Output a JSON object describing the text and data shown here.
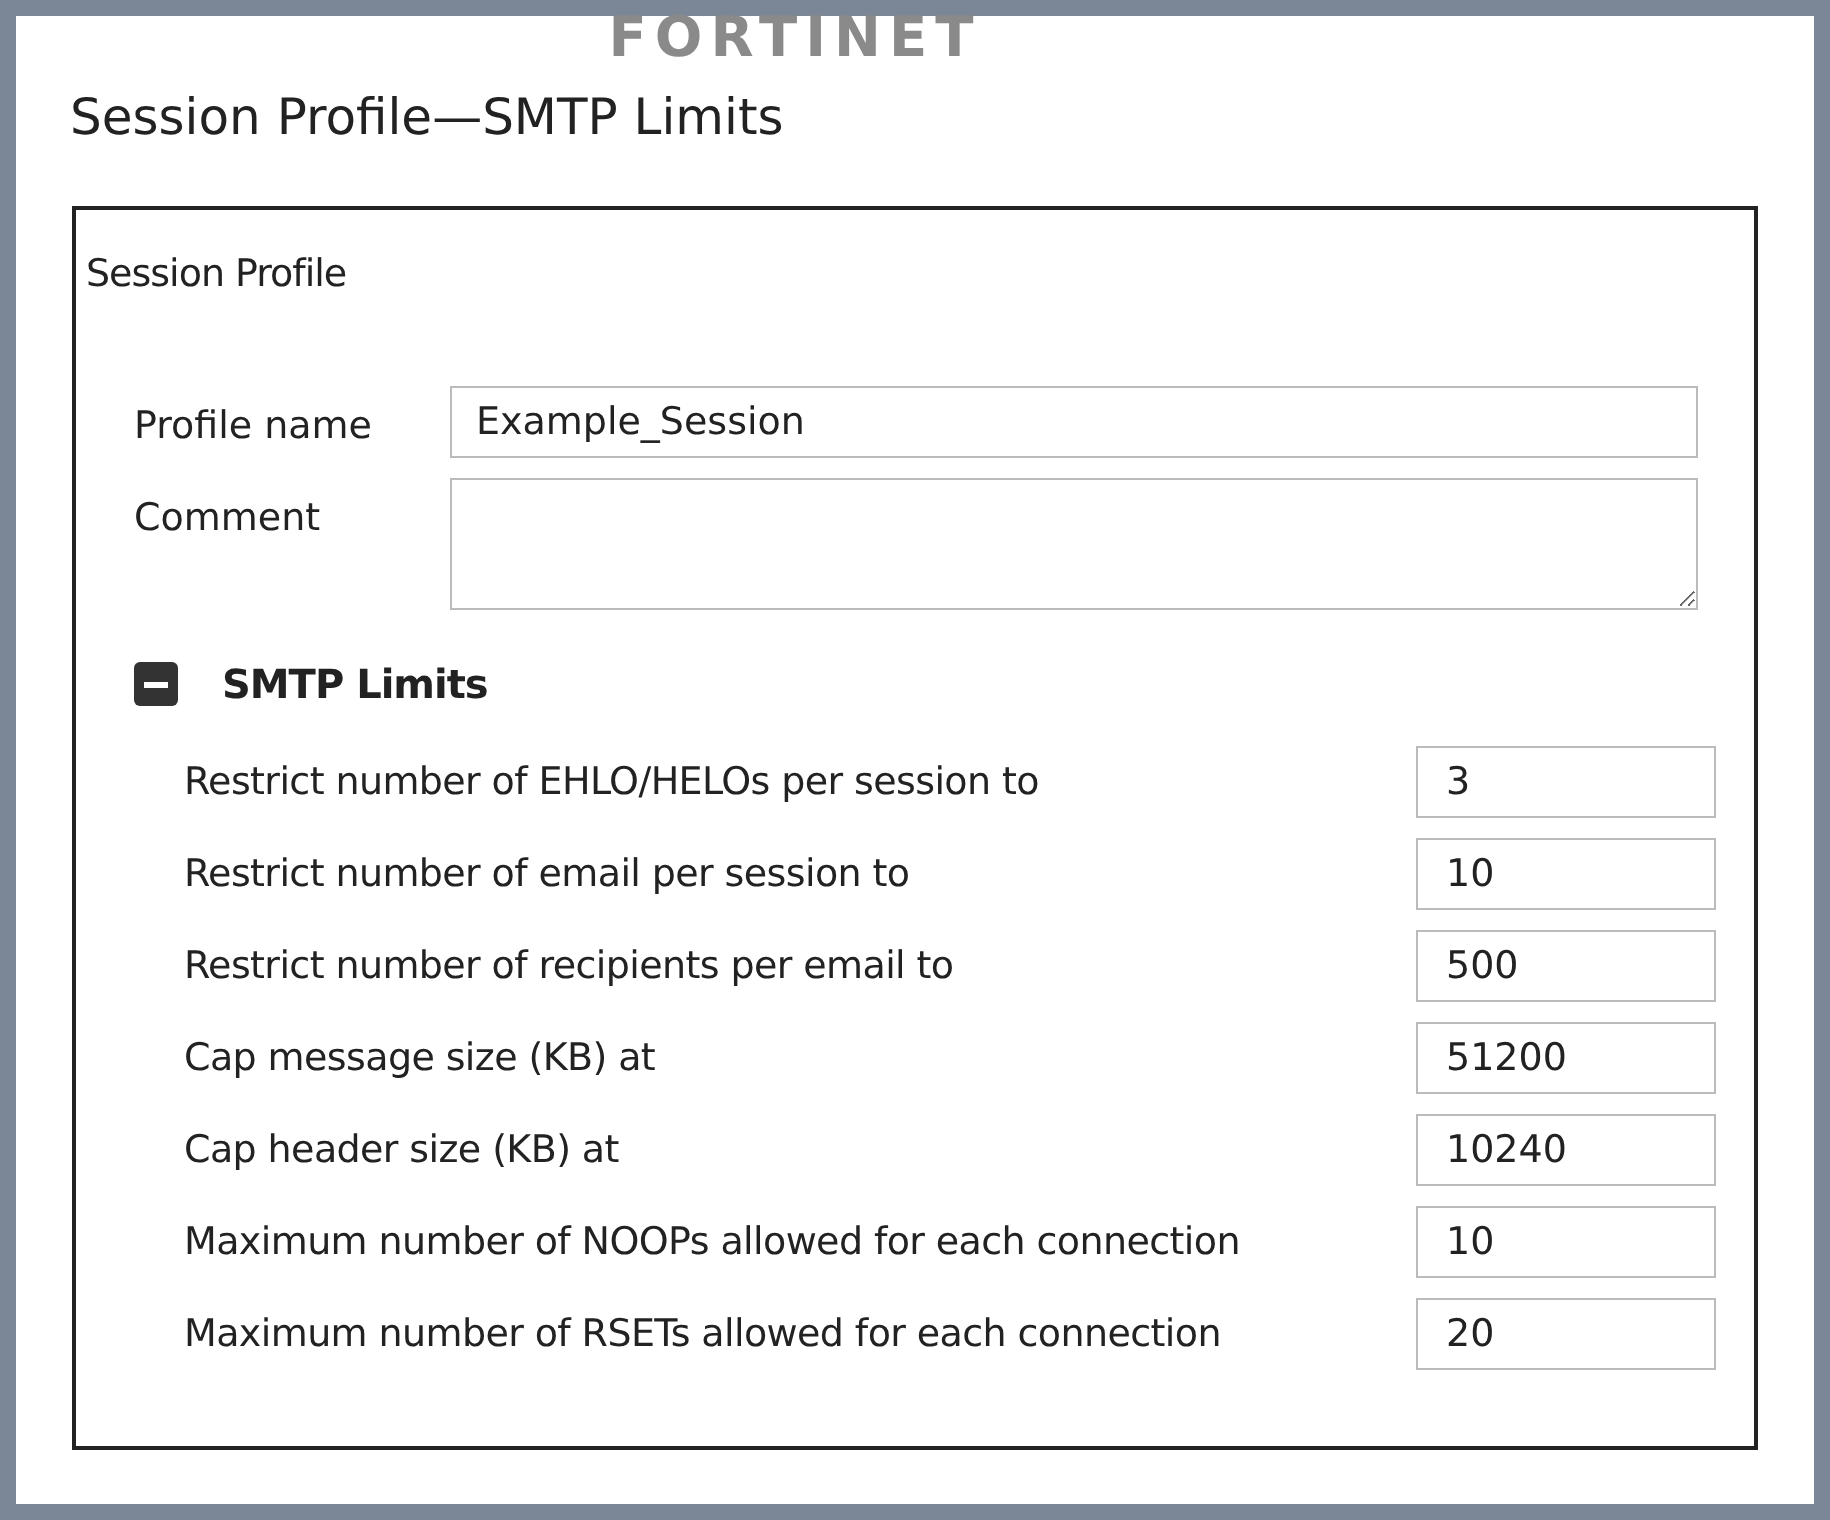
{
  "logo": "FORTINET",
  "title": "Session Profile—SMTP Limits",
  "panel": {
    "heading": "Session Profile",
    "fields": [
      {
        "kind": "input",
        "label": "Profile name",
        "value": "Example_Session"
      },
      {
        "kind": "textarea",
        "label": "Comment"
      }
    ],
    "section": {
      "title": "SMTP Limits",
      "expanded": true,
      "rows": [
        {
          "label": "Restrict number of EHLO/HELOs per session to",
          "value": "3"
        },
        {
          "label": "Restrict number of email per session to",
          "value": "10"
        },
        {
          "label": "Restrict number of recipients per email to",
          "value": "500"
        },
        {
          "label": "Cap message size (KB) at",
          "value": "51200"
        },
        {
          "label": "Cap header size (KB) at",
          "value": "10240"
        },
        {
          "label": "Maximum number of NOOPs allowed for each connection",
          "value": "10"
        },
        {
          "label": "Maximum number of RSETs allowed for each connection",
          "value": "20"
        }
      ]
    }
  }
}
